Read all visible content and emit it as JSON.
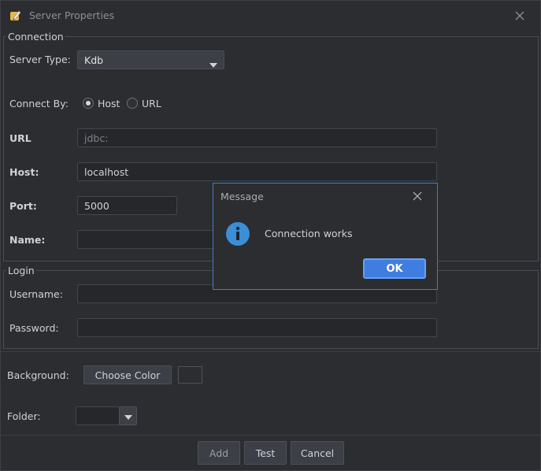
{
  "window": {
    "title": "Server Properties"
  },
  "connection": {
    "legend": "Connection",
    "server_type_label": "Server Type:",
    "server_type_value": "Kdb",
    "connect_by_label": "Connect By:",
    "connect_by_options": [
      "Host",
      "URL"
    ],
    "connect_by_selected": "Host",
    "url_label": "URL",
    "url_placeholder": "jdbc:",
    "host_label": "Host:",
    "host_value": "localhost",
    "port_label": "Port:",
    "port_value": "5000",
    "name_label": "Name:",
    "name_value": ""
  },
  "login": {
    "legend": "Login",
    "username_label": "Username:",
    "username_value": "",
    "password_label": "Password:",
    "password_value": ""
  },
  "background": {
    "label": "Background:",
    "button": "Choose Color"
  },
  "folder": {
    "label": "Folder:",
    "value": ""
  },
  "footer": {
    "add": "Add",
    "test": "Test",
    "cancel": "Cancel"
  },
  "message": {
    "title": "Message",
    "text": "Connection works",
    "ok": "OK"
  },
  "colors": {
    "accent": "#3f7de0",
    "background": "#2b2d30",
    "info_icon": "#3b8fd6"
  },
  "icons": [
    "app-pencil-icon",
    "close-icon",
    "chevron-down-icon",
    "info-icon"
  ]
}
